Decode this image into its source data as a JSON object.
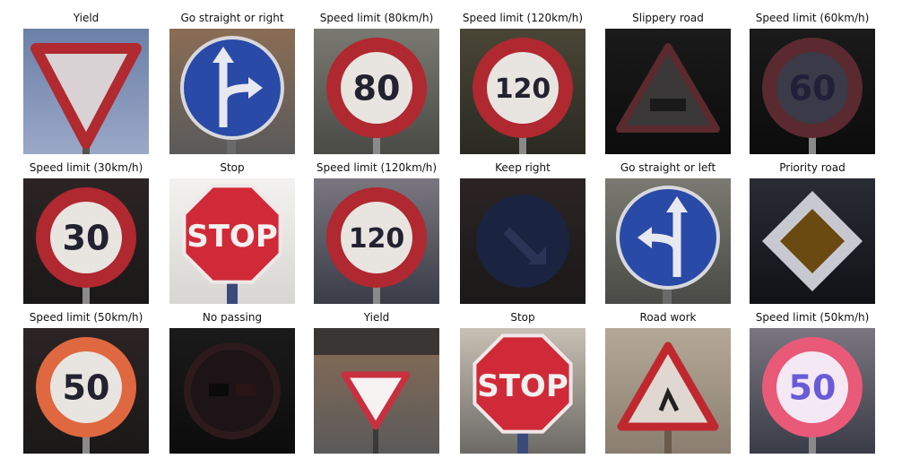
{
  "grid": {
    "rows": [
      [
        {
          "title": "Yield",
          "sign": "yield",
          "bg": "sky"
        },
        {
          "title": "Go straight or right",
          "sign": "straight-right",
          "bg": "building"
        },
        {
          "title": "Speed limit (80km/h)",
          "sign": "speed",
          "text": "80",
          "bg": "gray"
        },
        {
          "title": "Speed limit (120km/h)",
          "sign": "speed",
          "text": "120",
          "bg": "darkgreen"
        },
        {
          "title": "Slippery road",
          "sign": "warning-dark",
          "bg": "black"
        },
        {
          "title": "Speed limit (60km/h)",
          "sign": "speed-dark",
          "text": "60",
          "bg": "black"
        }
      ],
      [
        {
          "title": "Speed limit (30km/h)",
          "sign": "speed",
          "text": "30",
          "bg": "dark"
        },
        {
          "title": "Stop",
          "sign": "stop",
          "text": "STOP",
          "bg": "white"
        },
        {
          "title": "Speed limit (120km/h)",
          "sign": "speed",
          "text": "120",
          "bg": "noisy"
        },
        {
          "title": "Keep right",
          "sign": "keep-right",
          "bg": "dark"
        },
        {
          "title": "Go straight or left",
          "sign": "straight-left",
          "bg": "gray"
        },
        {
          "title": "Priority road",
          "sign": "priority",
          "bg": "noisy-dark"
        }
      ],
      [
        {
          "title": "Speed limit (50km/h)",
          "sign": "speed-orange",
          "text": "50",
          "bg": "dark"
        },
        {
          "title": "No passing",
          "sign": "no-passing-dark",
          "bg": "black"
        },
        {
          "title": "Yield",
          "sign": "yield-small",
          "bg": "building"
        },
        {
          "title": "Stop",
          "sign": "stop",
          "text": "STOP",
          "bg": "wall"
        },
        {
          "title": "Road work",
          "sign": "warning",
          "bg": "beige"
        },
        {
          "title": "Speed limit (50km/h)",
          "sign": "speed-pink",
          "text": "50",
          "bg": "noisy"
        }
      ]
    ]
  }
}
